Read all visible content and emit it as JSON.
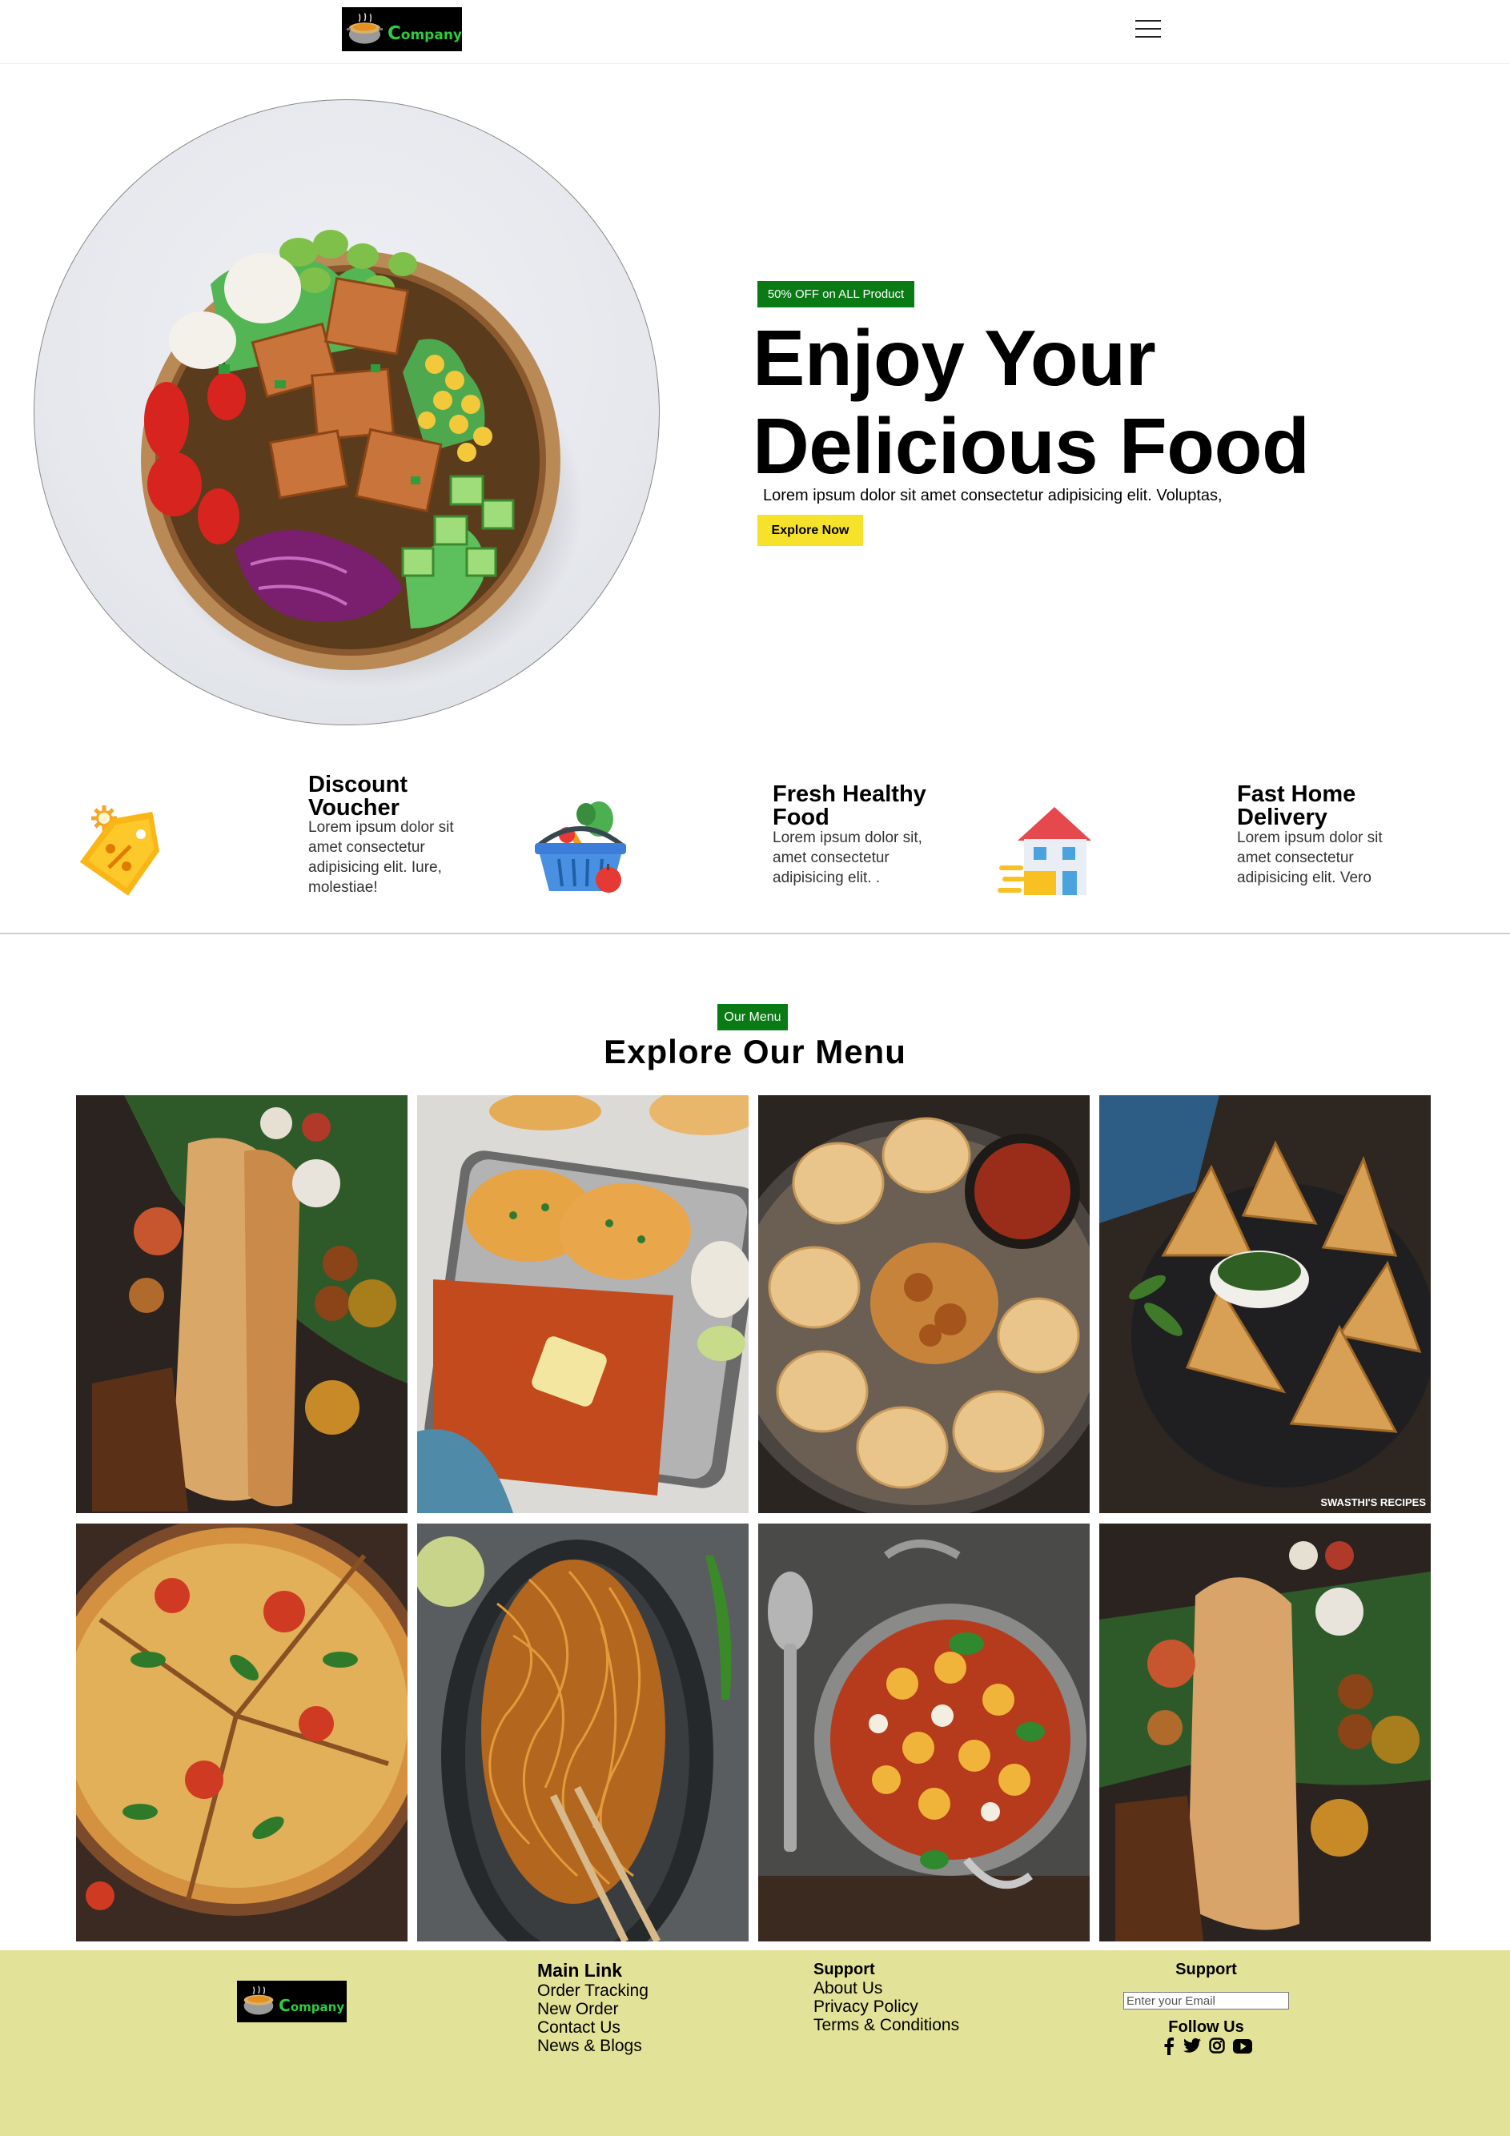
{
  "brand": {
    "logo_text": "Company"
  },
  "hero": {
    "badge": "50% OFF on ALL Product",
    "title_line1": "Enjoy Your",
    "title_line2": "Delicious Food",
    "text": "Lorem ipsum dolor sit amet consectetur adipisicing elit. Voluptas,",
    "button": "Explore Now"
  },
  "features": [
    {
      "title_line1": "Discount",
      "title_line2": "Voucher",
      "text_lines": [
        "Lorem ipsum dolor sit",
        "amet consectetur",
        "adipisicing elit. Iure,",
        "molestiae!"
      ],
      "icon": "discount-tag-icon"
    },
    {
      "title_line1": "Fresh Healthy",
      "title_line2": "Food",
      "text_lines": [
        "Lorem ipsum dolor sit,",
        "amet consectetur",
        "adipisicing elit. ."
      ],
      "icon": "vegetable-basket-icon"
    },
    {
      "title_line1": "Fast Home",
      "title_line2": "Delivery",
      "text_lines": [
        "Lorem ipsum dolor sit",
        "amet consectetur",
        "adipisicing elit. Vero"
      ],
      "icon": "home-delivery-icon"
    }
  ],
  "menu": {
    "badge": "Our Menu",
    "title": "Explore Our Menu",
    "items": [
      {
        "name": "masala-dosa"
      },
      {
        "name": "pav-bhaji"
      },
      {
        "name": "momos"
      },
      {
        "name": "samosa",
        "watermark": "SWASTHI'S RECIPES"
      },
      {
        "name": "pizza"
      },
      {
        "name": "noodles"
      },
      {
        "name": "gnocchi-pan"
      },
      {
        "name": "masala-dosa"
      }
    ]
  },
  "footer": {
    "main_link": {
      "heading": "Main Link",
      "links": [
        "Order Tracking",
        "New Order",
        "Contact Us",
        "News & Blogs"
      ]
    },
    "support": {
      "heading": "Support",
      "links": [
        "About Us",
        "Privacy Policy",
        "Terms & Conditions"
      ]
    },
    "newsletter": {
      "heading": "Support",
      "placeholder": "Enter your Email"
    },
    "follow": {
      "heading": "Follow Us",
      "icons": [
        "facebook-icon",
        "twitter-icon",
        "instagram-icon",
        "youtube-icon"
      ]
    }
  },
  "colors": {
    "accent_green": "#0a7a14",
    "button_yellow": "#f6e22a",
    "footer_bg": "#e2e298",
    "logo_green": "#2ecc40"
  }
}
